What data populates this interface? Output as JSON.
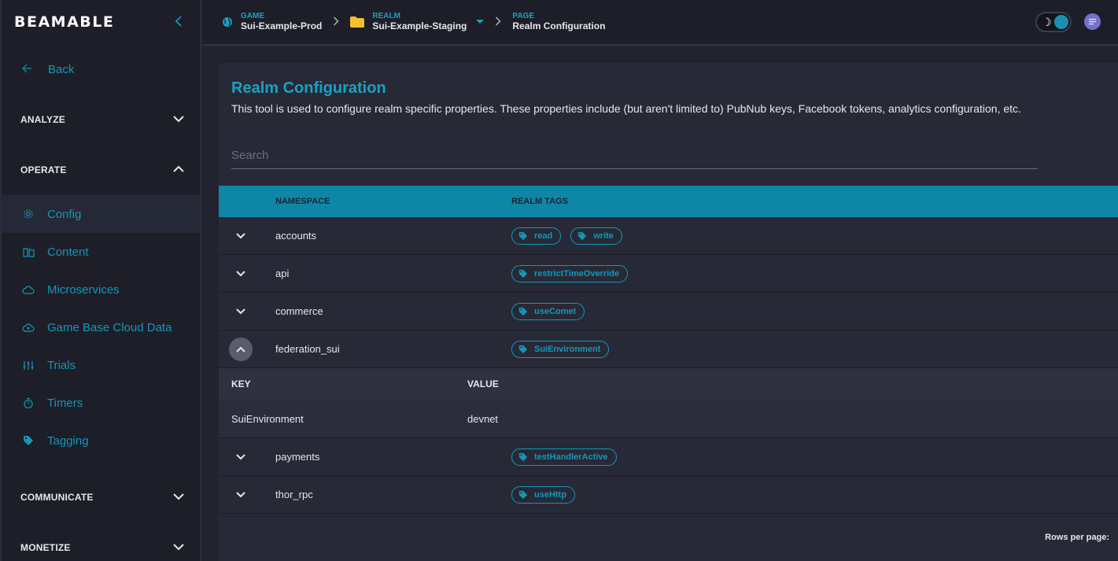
{
  "sidebar": {
    "logo": "BEAMABLE",
    "back_label": "Back",
    "sections": {
      "analyze": "ANALYZE",
      "operate": "OPERATE",
      "communicate": "COMMUNICATE",
      "monetize": "MONETIZE"
    },
    "items": [
      {
        "label": "Config",
        "icon": "gear-icon",
        "active": true
      },
      {
        "label": "Content",
        "icon": "content-icon"
      },
      {
        "label": "Microservices",
        "icon": "cloud-icon"
      },
      {
        "label": "Game Base Cloud Data",
        "icon": "cloud-upload-icon"
      },
      {
        "label": "Trials",
        "icon": "sliders-icon"
      },
      {
        "label": "Timers",
        "icon": "stopwatch-icon"
      },
      {
        "label": "Tagging",
        "icon": "tag-icon"
      }
    ]
  },
  "topbar": {
    "game": {
      "label": "GAME",
      "value": "Sui-Example-Prod"
    },
    "realm": {
      "label": "REALM",
      "value": "Sui-Example-Staging"
    },
    "page": {
      "label": "PAGE",
      "value": "Realm Configuration"
    }
  },
  "main": {
    "title": "Realm Configuration",
    "description": "This tool is used to configure realm specific properties. These properties include (but aren't limited to) PubNub keys, Facebook tokens, analytics configuration, etc.",
    "search_placeholder": "Search",
    "columns": {
      "namespace": "NAMESPACE",
      "tags": "REALM TAGS"
    },
    "rows": [
      {
        "namespace": "accounts",
        "tags": [
          "read",
          "write"
        ]
      },
      {
        "namespace": "api",
        "tags": [
          "restrictTimeOverride"
        ]
      },
      {
        "namespace": "commerce",
        "tags": [
          "useComet"
        ]
      },
      {
        "namespace": "federation_sui",
        "tags": [
          "SuiEnvironment"
        ],
        "expanded": true
      },
      {
        "namespace": "payments",
        "tags": [
          "testHandlerActive"
        ]
      },
      {
        "namespace": "thor_rpc",
        "tags": [
          "useHttp"
        ]
      }
    ],
    "detail": {
      "key_header": "KEY",
      "value_header": "VALUE",
      "rows": [
        {
          "key": "SuiEnvironment",
          "value": "devnet"
        }
      ]
    },
    "footer": {
      "rows_per_page": "Rows per page:"
    }
  },
  "colors": {
    "accent": "#1497b8",
    "header_bar": "#0e87a7",
    "background": "#22232e"
  }
}
